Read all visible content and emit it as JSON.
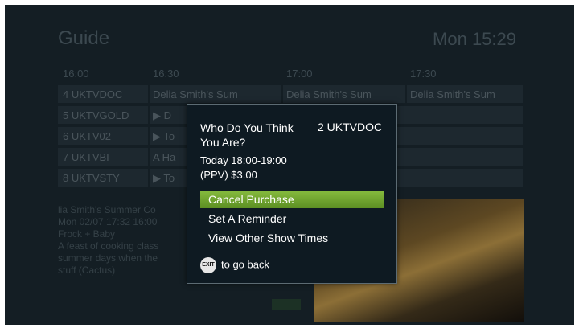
{
  "guide": {
    "title": "Guide",
    "datetime": "Mon 15:29",
    "timeline": [
      "16:00",
      "16:30",
      "17:00",
      "17:30"
    ],
    "rows": [
      {
        "channel": "4 UKTVDOC",
        "program": "Delia Smith's Sum",
        "cell2": "Delia Smith's Sum",
        "cell3": "Delia Smith's Sum"
      },
      {
        "channel": "5 UKTVGOLD",
        "program": "▶ D",
        "cell2": "",
        "cell3": ""
      },
      {
        "channel": "6 UKTV02",
        "program": "▶ To",
        "cell2": "",
        "cell3": ""
      },
      {
        "channel": "7 UKTVBI",
        "program": "A Ha",
        "cell2": "",
        "cell3": ""
      },
      {
        "channel": "8 UKTVSTY",
        "program": "▶ To",
        "cell2": "",
        "cell3": ""
      }
    ],
    "info_lines": [
      "lia Smith's Summer Co",
      "Mon 02/07 17:32 16:00",
      "Frock + Baby",
      "A feast of cooking class",
      "summer days when the",
      "stuff (Cactus)"
    ]
  },
  "modal": {
    "title": "Who Do You Think You Are?",
    "channel": "2 UKTVDOC",
    "time": "Today 18:00-19:00",
    "price": "(PPV) $3.00",
    "options": [
      "Cancel Purchase",
      "Set A Reminder",
      "View Other Show Times"
    ],
    "back_icon": "EXIT",
    "back_text": "to go back"
  },
  "colors": {
    "accent": "#7aa83a",
    "modal_bg": "#0e1a22"
  }
}
